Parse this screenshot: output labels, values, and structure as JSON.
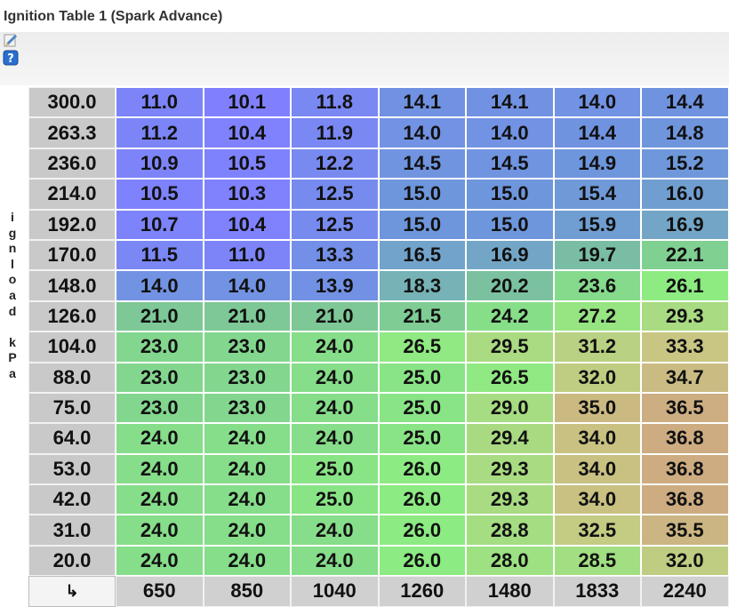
{
  "title": "Ignition Table 1 (Spark Advance)",
  "toolbar": {
    "edit_icon": "pencil-edit-icon",
    "help_icon": "question-help-icon"
  },
  "y_axis_label": [
    "i",
    "g",
    "n",
    "l",
    "o",
    "a",
    "d",
    "",
    "k",
    "P",
    "a"
  ],
  "corner_icon": "↳",
  "row_headers": [
    "300.0",
    "263.3",
    "236.0",
    "214.0",
    "192.0",
    "170.0",
    "148.0",
    "126.0",
    "104.0",
    "88.0",
    "75.0",
    "64.0",
    "53.0",
    "42.0",
    "31.0",
    "20.0"
  ],
  "col_headers": [
    "650",
    "850",
    "1040",
    "1260",
    "1480",
    "1833",
    "2240"
  ],
  "cells": [
    [
      "11.0",
      "10.1",
      "11.8",
      "14.1",
      "14.1",
      "14.0",
      "14.4"
    ],
    [
      "11.2",
      "10.4",
      "11.9",
      "14.0",
      "14.0",
      "14.4",
      "14.8"
    ],
    [
      "10.9",
      "10.5",
      "12.2",
      "14.5",
      "14.5",
      "14.9",
      "15.2"
    ],
    [
      "10.5",
      "10.3",
      "12.5",
      "15.0",
      "15.0",
      "15.4",
      "16.0"
    ],
    [
      "10.7",
      "10.4",
      "12.5",
      "15.0",
      "15.0",
      "15.9",
      "16.9"
    ],
    [
      "11.5",
      "11.0",
      "13.3",
      "16.5",
      "16.9",
      "19.7",
      "22.1"
    ],
    [
      "14.0",
      "14.0",
      "13.9",
      "18.3",
      "20.2",
      "23.6",
      "26.1"
    ],
    [
      "21.0",
      "21.0",
      "21.0",
      "21.5",
      "24.2",
      "27.2",
      "29.3"
    ],
    [
      "23.0",
      "23.0",
      "24.0",
      "26.5",
      "29.5",
      "31.2",
      "33.3"
    ],
    [
      "23.0",
      "23.0",
      "24.0",
      "25.0",
      "26.5",
      "32.0",
      "34.7"
    ],
    [
      "23.0",
      "23.0",
      "24.0",
      "25.0",
      "29.0",
      "35.0",
      "36.5"
    ],
    [
      "24.0",
      "24.0",
      "24.0",
      "25.0",
      "29.4",
      "34.0",
      "36.8"
    ],
    [
      "24.0",
      "24.0",
      "25.0",
      "26.0",
      "29.3",
      "34.0",
      "36.8"
    ],
    [
      "24.0",
      "24.0",
      "25.0",
      "26.0",
      "29.3",
      "34.0",
      "36.8"
    ],
    [
      "24.0",
      "24.0",
      "24.0",
      "26.0",
      "28.8",
      "32.5",
      "35.5"
    ],
    [
      "24.0",
      "24.0",
      "24.0",
      "26.0",
      "28.0",
      "28.5",
      "32.0"
    ]
  ]
}
